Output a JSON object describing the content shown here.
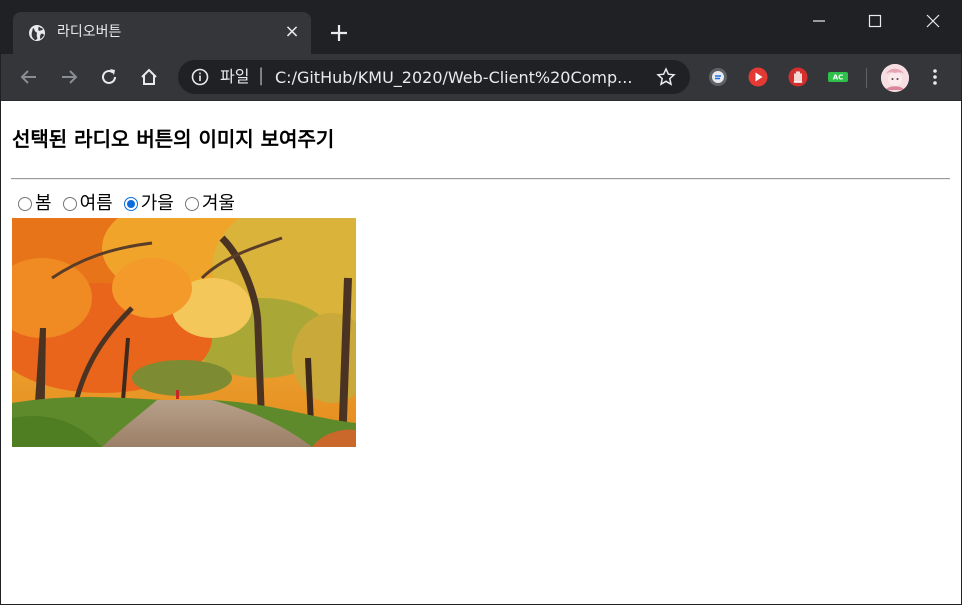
{
  "tab": {
    "title": "라디오버튼",
    "close_glyph": "×"
  },
  "omnibox": {
    "scheme_label": "파일",
    "separator": "|",
    "url": "C:/GitHub/KMU_2020/Web-Client%20Comp..."
  },
  "icons": {
    "tab": "globe-icon",
    "new_tab": "plus-icon",
    "minimize": "minimize-icon",
    "maximize": "maximize-icon",
    "close": "close-icon",
    "back": "back-arrow-icon",
    "forward": "forward-arrow-icon",
    "reload": "reload-icon",
    "home": "home-icon",
    "info": "info-icon",
    "bookmark": "star-icon",
    "extensions": [
      "ghost-extension-icon",
      "play-extension-icon",
      "hand-stop-extension-icon",
      "ac-extension-icon"
    ],
    "profile": "avatar",
    "menu": "more-vertical-icon"
  },
  "colors": {
    "titlebar": "#202124",
    "toolbar": "#35363a",
    "radio_selected": "#0b6cde"
  },
  "extensions": {
    "ac_badge": "AC"
  },
  "page": {
    "heading": "선택된 라디오 버튼의 이미지 보여주기",
    "radios": [
      {
        "label": "봄",
        "checked": false
      },
      {
        "label": "여름",
        "checked": false
      },
      {
        "label": "가을",
        "checked": true
      },
      {
        "label": "겨울",
        "checked": false
      }
    ],
    "image_subject": "autumn-forest-road"
  }
}
